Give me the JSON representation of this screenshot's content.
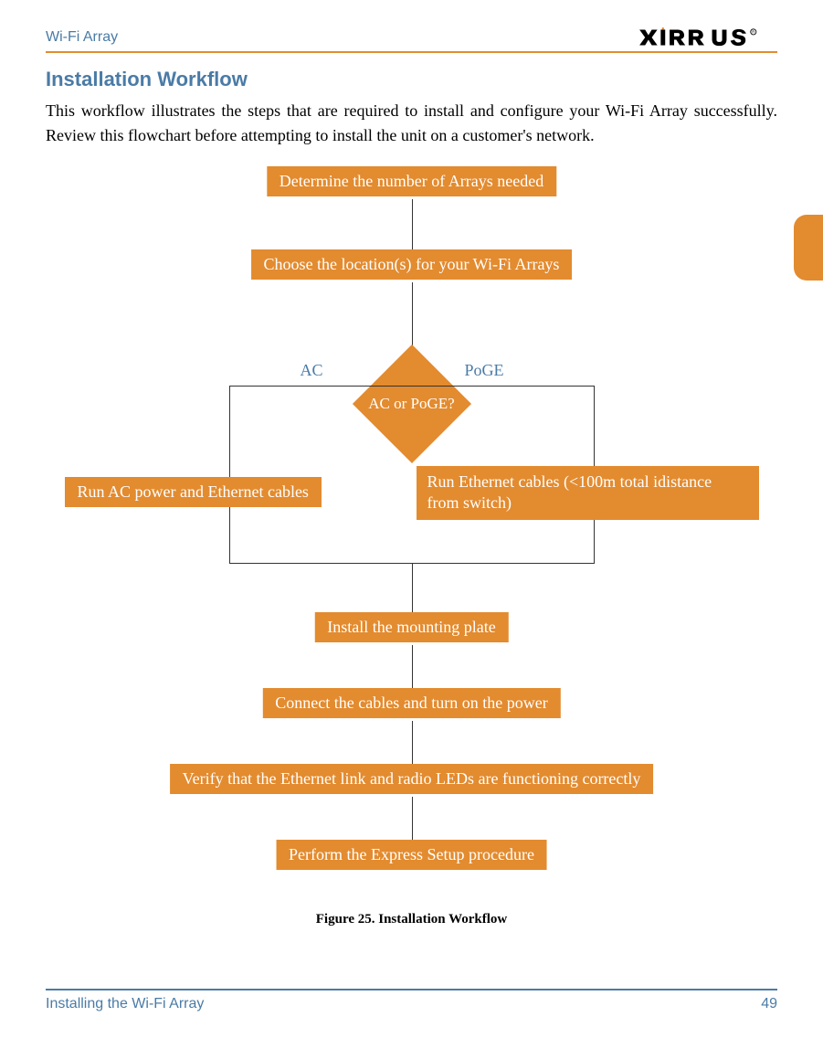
{
  "header": {
    "title": "Wi-Fi Array",
    "brand": "XIRRUS"
  },
  "section": {
    "title": "Installation Workflow",
    "intro": "This workflow illustrates the steps that are required to install and configure your Wi-Fi Array successfully. Review this flowchart before attempting to install the unit on a customer's network."
  },
  "flow": {
    "step1": "Determine the number of Arrays needed",
    "step2": "Choose the location(s) for your Wi-Fi Arrays",
    "decision": "AC or PoGE?",
    "branch_left_label": "AC",
    "branch_right_label": "PoGE",
    "branch_left_box": "Run AC power and Ethernet cables",
    "branch_right_box": "Run Ethernet cables (<100m total idistance from switch)",
    "step3": "Install the mounting plate",
    "step4": "Connect the cables and turn on the power",
    "step5": "Verify that the Ethernet link and radio LEDs are functioning correctly",
    "step6": "Perform the Express Setup procedure"
  },
  "figure_caption": "Figure 25. Installation Workflow",
  "footer": {
    "section": "Installing the Wi-Fi Array",
    "page": "49"
  }
}
